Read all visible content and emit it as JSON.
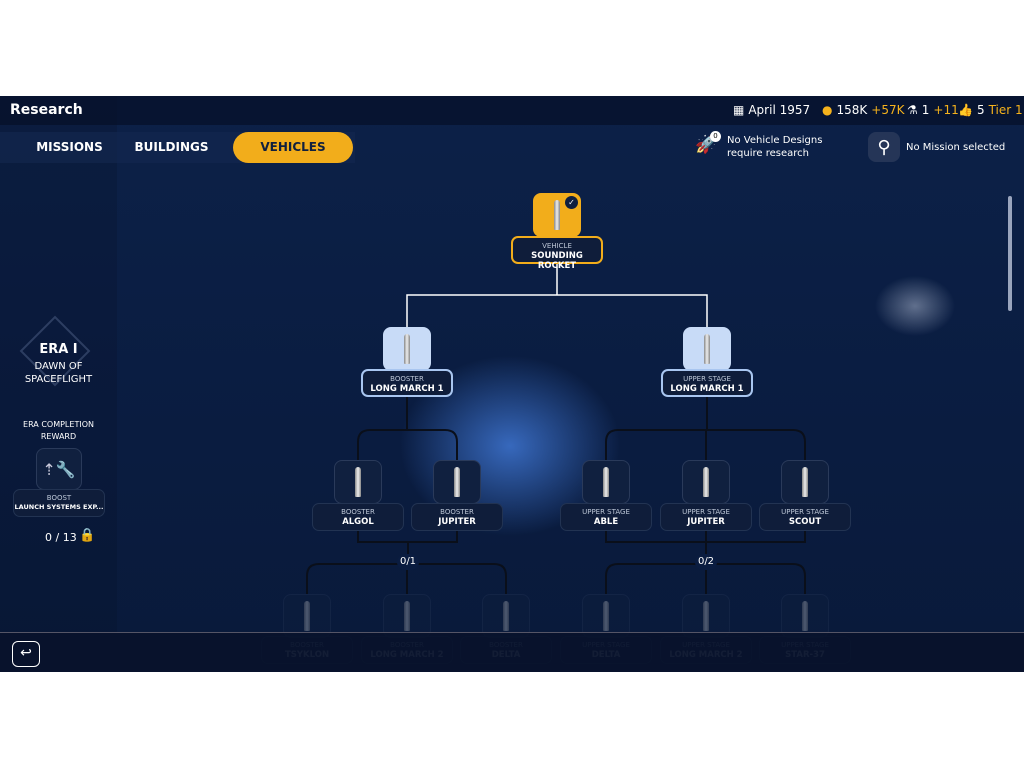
{
  "header": {
    "title": "Research",
    "date": "April 1957",
    "money": "158K",
    "money_delta": "+57K",
    "science": "1",
    "science_delta": "+11",
    "reputation": "5",
    "tier": "Tier 1"
  },
  "tabs": [
    {
      "label": "MISSIONS"
    },
    {
      "label": "BUILDINGS"
    },
    {
      "label": "VEHICLES",
      "active": true
    }
  ],
  "notice": {
    "badge": "0",
    "line1": "No Vehicle Designs",
    "line2": "require research"
  },
  "mission": {
    "text": "No Mission selected"
  },
  "era": {
    "title": "ERA I",
    "subtitle1": "DAWN OF",
    "subtitle2": "SPACEFLIGHT",
    "reward_heading1": "ERA COMPLETION",
    "reward_heading2": "REWARD",
    "reward_type": "BOOST",
    "reward_name": "LAUNCH SYSTEMS EXP...",
    "progress": "0 / 13"
  },
  "tree": {
    "root": {
      "type": "VEHICLE",
      "name": "SOUNDING ROCKET"
    },
    "level2": [
      {
        "type": "BOOSTER",
        "name": "LONG MARCH 1"
      },
      {
        "type": "UPPER STAGE",
        "name": "LONG MARCH 1"
      }
    ],
    "level3": [
      {
        "type": "BOOSTER",
        "name": "ALGOL"
      },
      {
        "type": "BOOSTER",
        "name": "JUPITER"
      },
      {
        "type": "UPPER STAGE",
        "name": "ABLE"
      },
      {
        "type": "UPPER STAGE",
        "name": "JUPITER"
      },
      {
        "type": "UPPER STAGE",
        "name": "SCOUT"
      }
    ],
    "counters": [
      "0/1",
      "0/2"
    ],
    "level4": [
      {
        "type": "BOOSTER",
        "name": "TSYKLON"
      },
      {
        "type": "BOOSTER",
        "name": "LONG MARCH 2"
      },
      {
        "type": "BOOSTER",
        "name": "DELTA"
      },
      {
        "type": "UPPER STAGE",
        "name": "DELTA"
      },
      {
        "type": "UPPER STAGE",
        "name": "LONG MARCH 2"
      },
      {
        "type": "UPPER STAGE",
        "name": "STAR-37"
      }
    ]
  }
}
